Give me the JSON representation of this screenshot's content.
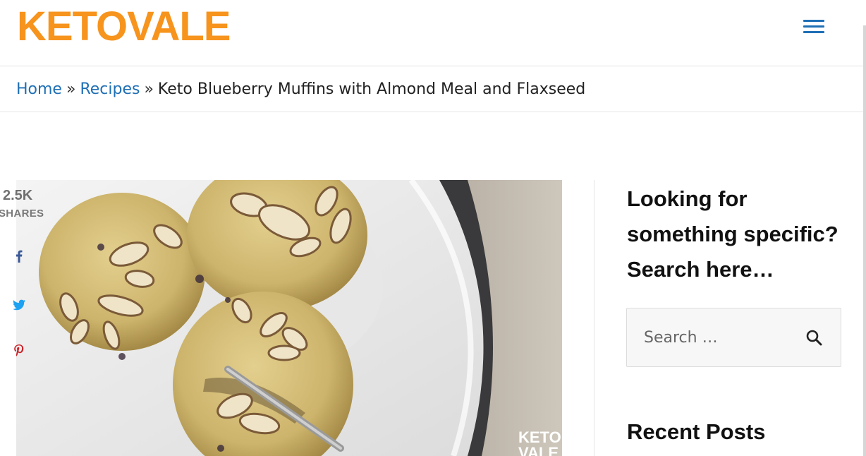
{
  "header": {
    "logo_text": "KETOVALE",
    "brand_color": "#f7941d",
    "menu_icon": "hamburger-menu-icon"
  },
  "breadcrumb": {
    "home": "Home",
    "separator": "»",
    "recipes": "Recipes",
    "current": "Keto Blueberry Muffins with Almond Meal and Flaxseed",
    "link_color": "#1f6fb5"
  },
  "share": {
    "count": "2.5K",
    "label": "SHARES",
    "icons": [
      "facebook-icon",
      "twitter-icon",
      "pinterest-icon"
    ],
    "colors": {
      "facebook": "#3b5998",
      "twitter": "#1da1f2",
      "pinterest": "#cb2027"
    }
  },
  "hero": {
    "watermark_line1": "KETO",
    "watermark_line2": "VALE"
  },
  "sidebar": {
    "search_heading": "Looking for something specific? Search here…",
    "search_placeholder": "Search …",
    "search_icon": "search-icon",
    "recent_heading": "Recent Posts"
  }
}
